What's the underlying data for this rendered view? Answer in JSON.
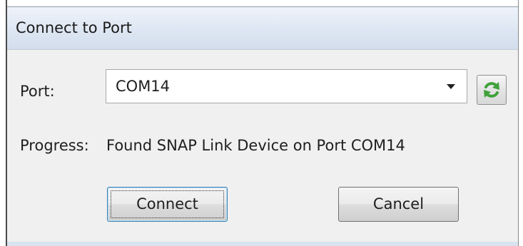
{
  "window": {
    "title": "Connect to Port"
  },
  "port": {
    "label": "Port:",
    "selected_value": "COM14"
  },
  "progress": {
    "label": "Progress:",
    "message": "Found SNAP Link Device on Port COM14"
  },
  "buttons": {
    "connect_label": "Connect",
    "cancel_label": "Cancel"
  },
  "icons": {
    "refresh": "refresh-icon"
  },
  "colors": {
    "titlebar": "#dde6f2",
    "dialog_background": "#f0f0f0",
    "refresh_icon_green": "#3fa23a"
  }
}
